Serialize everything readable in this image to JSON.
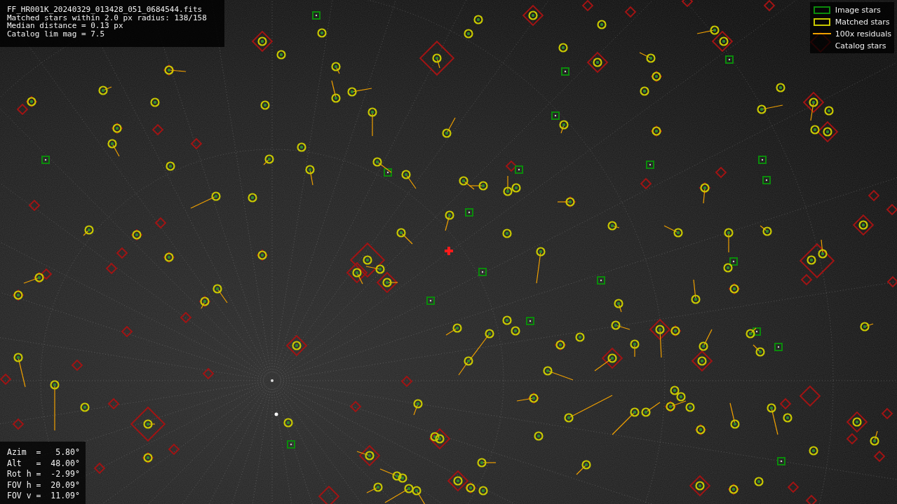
{
  "file_info": {
    "lines": [
      "FF_HR001K_20240329_013428_051_0684544.fits",
      "Matched stars within 2.0 px radius: 138/158",
      "Median distance = 0.13 px",
      "Catalog lim mag = 7.5"
    ]
  },
  "legend": [
    {
      "kind": "box",
      "label": "Image stars",
      "color": "#0b8a0b"
    },
    {
      "kind": "box",
      "label": "Matched stars",
      "color": "#c8c800"
    },
    {
      "kind": "line",
      "label": "100x residuals",
      "color": "#f0a000"
    },
    {
      "kind": "blank",
      "label": "Catalog stars"
    }
  ],
  "pointing": {
    "lines": [
      "Azim  =   5.80°",
      "Alt   =  48.00°",
      "Rot h =  -2.99°",
      "FOV h =  20.09°",
      "FOV v =  11.09°"
    ]
  }
}
